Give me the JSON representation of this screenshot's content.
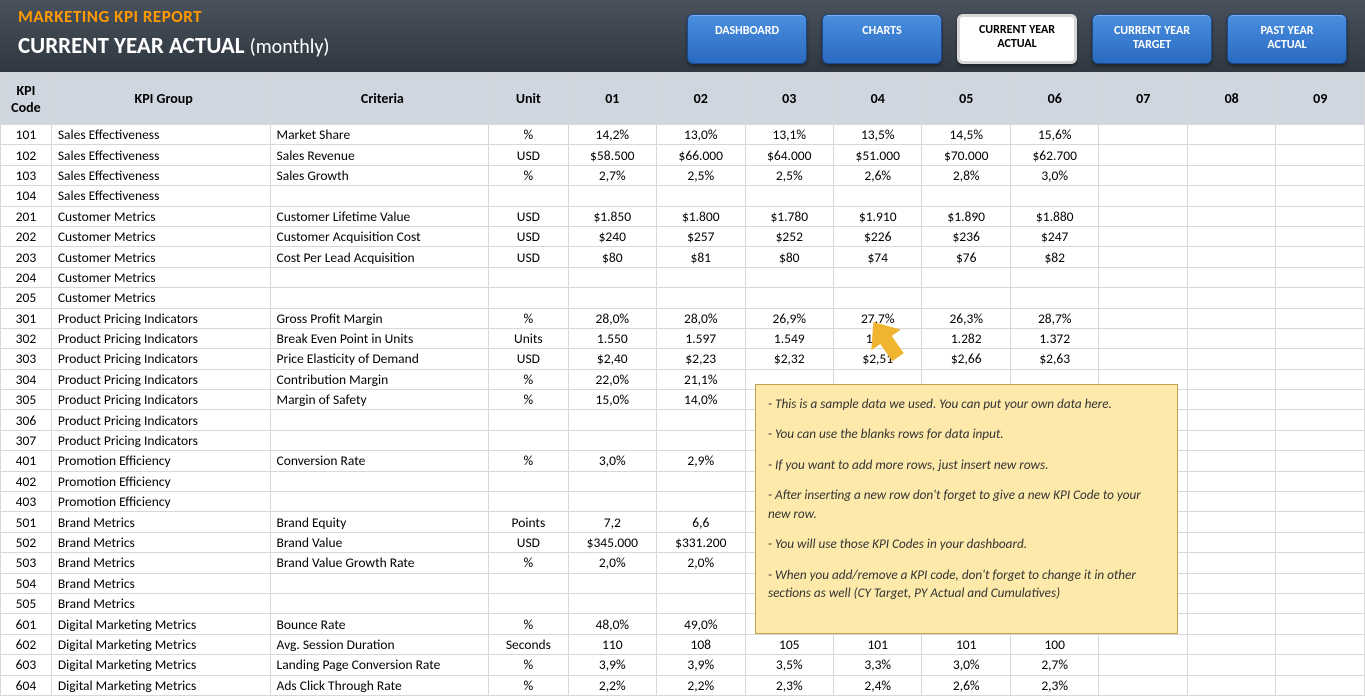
{
  "header": {
    "title": "MARKETING KPI REPORT",
    "subtitle": "CURRENT YEAR ACTUAL",
    "subtitle_suffix": "(monthly)"
  },
  "nav": [
    {
      "label": "DASHBOARD",
      "active": false
    },
    {
      "label": "CHARTS",
      "active": false
    },
    {
      "label": "CURRENT YEAR ACTUAL",
      "active": true
    },
    {
      "label": "CURRENT YEAR TARGET",
      "active": false
    },
    {
      "label": "PAST YEAR ACTUAL",
      "active": false
    }
  ],
  "columns": [
    "KPI Code",
    "KPI Group",
    "Criteria",
    "Unit",
    "01",
    "02",
    "03",
    "04",
    "05",
    "06",
    "07",
    "08",
    "09"
  ],
  "rows": [
    {
      "code": "101",
      "group": "Sales Effectiveness",
      "criteria": "Market Share",
      "unit": "%",
      "m": [
        "14,2%",
        "13,0%",
        "13,1%",
        "13,5%",
        "14,5%",
        "15,6%",
        "",
        "",
        ""
      ]
    },
    {
      "code": "102",
      "group": "Sales Effectiveness",
      "criteria": "Sales Revenue",
      "unit": "USD",
      "m": [
        "$58.500",
        "$66.000",
        "$64.000",
        "$51.000",
        "$70.000",
        "$62.700",
        "",
        "",
        ""
      ]
    },
    {
      "code": "103",
      "group": "Sales Effectiveness",
      "criteria": "Sales Growth",
      "unit": "%",
      "m": [
        "2,7%",
        "2,5%",
        "2,5%",
        "2,6%",
        "2,8%",
        "3,0%",
        "",
        "",
        ""
      ]
    },
    {
      "code": "104",
      "group": "Sales Effectiveness",
      "criteria": "",
      "unit": "",
      "m": [
        "",
        "",
        "",
        "",
        "",
        "",
        "",
        "",
        ""
      ]
    },
    {
      "code": "201",
      "group": "Customer Metrics",
      "criteria": "Customer Lifetime Value",
      "unit": "USD",
      "m": [
        "$1.850",
        "$1.800",
        "$1.780",
        "$1.910",
        "$1.890",
        "$1.880",
        "",
        "",
        ""
      ]
    },
    {
      "code": "202",
      "group": "Customer Metrics",
      "criteria": "Customer Acquisition Cost",
      "unit": "USD",
      "m": [
        "$240",
        "$257",
        "$252",
        "$226",
        "$236",
        "$247",
        "",
        "",
        ""
      ]
    },
    {
      "code": "203",
      "group": "Customer Metrics",
      "criteria": "Cost Per Lead Acquisition",
      "unit": "USD",
      "m": [
        "$80",
        "$81",
        "$80",
        "$74",
        "$76",
        "$82",
        "",
        "",
        ""
      ]
    },
    {
      "code": "204",
      "group": "Customer Metrics",
      "criteria": "",
      "unit": "",
      "m": [
        "",
        "",
        "",
        "",
        "",
        "",
        "",
        "",
        ""
      ]
    },
    {
      "code": "205",
      "group": "Customer Metrics",
      "criteria": "",
      "unit": "",
      "m": [
        "",
        "",
        "",
        "",
        "",
        "",
        "",
        "",
        ""
      ]
    },
    {
      "code": "301",
      "group": "Product Pricing Indicators",
      "criteria": "Gross Profit Margin",
      "unit": "%",
      "m": [
        "28,0%",
        "28,0%",
        "26,9%",
        "27,7%",
        "26,3%",
        "28,7%",
        "",
        "",
        ""
      ]
    },
    {
      "code": "302",
      "group": "Product Pricing Indicators",
      "criteria": "Break Even Point in Units",
      "unit": "Units",
      "m": [
        "1.550",
        "1.597",
        "1.549",
        "1.39",
        "1.282",
        "1.372",
        "",
        "",
        ""
      ]
    },
    {
      "code": "303",
      "group": "Product Pricing Indicators",
      "criteria": "Price Elasticity of Demand",
      "unit": "USD",
      "m": [
        "$2,40",
        "$2,23",
        "$2,32",
        "$2,51",
        "$2,66",
        "$2,63",
        "",
        "",
        ""
      ]
    },
    {
      "code": "304",
      "group": "Product Pricing Indicators",
      "criteria": "Contribution Margin",
      "unit": "%",
      "m": [
        "22,0%",
        "21,1%",
        "",
        "",
        "",
        "",
        "",
        "",
        ""
      ]
    },
    {
      "code": "305",
      "group": "Product Pricing Indicators",
      "criteria": "Margin of Safety",
      "unit": "%",
      "m": [
        "15,0%",
        "14,0%",
        "",
        "",
        "",
        "",
        "",
        "",
        ""
      ]
    },
    {
      "code": "306",
      "group": "Product Pricing Indicators",
      "criteria": "",
      "unit": "",
      "m": [
        "",
        "",
        "",
        "",
        "",
        "",
        "",
        "",
        ""
      ]
    },
    {
      "code": "307",
      "group": "Product Pricing Indicators",
      "criteria": "",
      "unit": "",
      "m": [
        "",
        "",
        "",
        "",
        "",
        "",
        "",
        "",
        ""
      ]
    },
    {
      "code": "401",
      "group": "Promotion Efficiency",
      "criteria": "Conversion Rate",
      "unit": "%",
      "m": [
        "3,0%",
        "2,9%",
        "",
        "",
        "",
        "",
        "",
        "",
        ""
      ]
    },
    {
      "code": "402",
      "group": "Promotion Efficiency",
      "criteria": "",
      "unit": "",
      "m": [
        "",
        "",
        "",
        "",
        "",
        "",
        "",
        "",
        ""
      ]
    },
    {
      "code": "403",
      "group": "Promotion Efficiency",
      "criteria": "",
      "unit": "",
      "m": [
        "",
        "",
        "",
        "",
        "",
        "",
        "",
        "",
        ""
      ]
    },
    {
      "code": "501",
      "group": "Brand Metrics",
      "criteria": "Brand Equity",
      "unit": "Points",
      "m": [
        "7,2",
        "6,6",
        "",
        "",
        "",
        "",
        "",
        "",
        ""
      ]
    },
    {
      "code": "502",
      "group": "Brand Metrics",
      "criteria": "Brand Value",
      "unit": "USD",
      "m": [
        "$345.000",
        "$331.200",
        "",
        "",
        "",
        "",
        "",
        "",
        ""
      ]
    },
    {
      "code": "503",
      "group": "Brand Metrics",
      "criteria": "Brand Value Growth Rate",
      "unit": "%",
      "m": [
        "2,0%",
        "2,0%",
        "",
        "",
        "",
        "",
        "",
        "",
        ""
      ]
    },
    {
      "code": "504",
      "group": "Brand Metrics",
      "criteria": "",
      "unit": "",
      "m": [
        "",
        "",
        "",
        "",
        "",
        "",
        "",
        "",
        ""
      ]
    },
    {
      "code": "505",
      "group": "Brand Metrics",
      "criteria": "",
      "unit": "",
      "m": [
        "",
        "",
        "",
        "",
        "",
        "",
        "",
        "",
        ""
      ]
    },
    {
      "code": "601",
      "group": "Digital Marketing Metrics",
      "criteria": "Bounce Rate",
      "unit": "%",
      "m": [
        "48,0%",
        "49,0%",
        "",
        "",
        "",
        "",
        "",
        "",
        ""
      ]
    },
    {
      "code": "602",
      "group": "Digital Marketing Metrics",
      "criteria": "Avg. Session Duration",
      "unit": "Seconds",
      "m": [
        "110",
        "108",
        "105",
        "101",
        "101",
        "100",
        "",
        "",
        ""
      ]
    },
    {
      "code": "603",
      "group": "Digital Marketing Metrics",
      "criteria": "Landing Page Conversion Rate",
      "unit": "%",
      "m": [
        "3,9%",
        "3,9%",
        "3,5%",
        "3,3%",
        "3,0%",
        "2,7%",
        "",
        "",
        ""
      ]
    },
    {
      "code": "604",
      "group": "Digital Marketing Metrics",
      "criteria": "Ads Click Through Rate",
      "unit": "%",
      "m": [
        "2,2%",
        "2,2%",
        "2,3%",
        "2,4%",
        "2,6%",
        "2,3%",
        "",
        "",
        ""
      ]
    }
  ],
  "note": [
    "- This is a sample data we used. You can put your own data here.",
    "- You can use the blanks rows for data input.",
    "- If you want to add more rows, just insert new rows.",
    "- After inserting a new row don't forget to give a new KPI Code to your new row.",
    "- You will use those KPI Codes in your dashboard.",
    "- When you add/remove a KPI code, don't forget to change it in other sections as well (CY Target, PY Actual and Cumulatives)"
  ]
}
